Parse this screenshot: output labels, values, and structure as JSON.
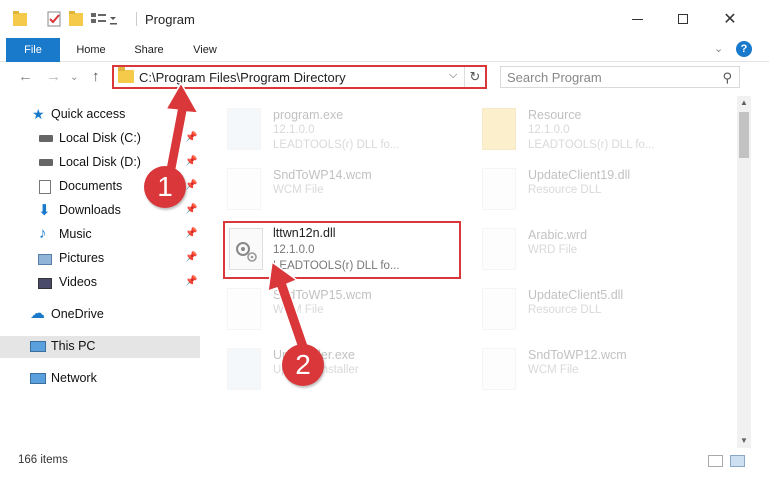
{
  "window": {
    "title": "Program",
    "controls": [
      "minimize-icon",
      "maximize-icon",
      "close-icon"
    ]
  },
  "ribbon": {
    "tabs": [
      {
        "label": "File",
        "active": true
      },
      {
        "label": "Home"
      },
      {
        "label": "Share"
      },
      {
        "label": "View"
      }
    ],
    "help_label": "?"
  },
  "address": {
    "path": "C:\\Program Files\\Program Directory",
    "refresh_icon": "↻"
  },
  "search": {
    "placeholder": "Search Program"
  },
  "sidebar": {
    "items": [
      {
        "label": "Quick access",
        "icon": "star-icon",
        "pinned": false
      },
      {
        "label": "Local Disk (C:)",
        "icon": "drive-icon",
        "pinned": true
      },
      {
        "label": "Local Disk (D:)",
        "icon": "drive-icon",
        "pinned": true
      },
      {
        "label": "Documents",
        "icon": "documents-icon",
        "pinned": true
      },
      {
        "label": "Downloads",
        "icon": "download-icon",
        "pinned": true
      },
      {
        "label": "Music",
        "icon": "music-icon",
        "pinned": true
      },
      {
        "label": "Pictures",
        "icon": "pictures-icon",
        "pinned": true
      },
      {
        "label": "Videos",
        "icon": "videos-icon",
        "pinned": true
      },
      {
        "label": "OneDrive",
        "icon": "cloud-icon",
        "pinned": false
      },
      {
        "label": "This PC",
        "icon": "computer-icon",
        "pinned": false,
        "selected": true
      },
      {
        "label": "Network",
        "icon": "network-icon",
        "pinned": false
      }
    ]
  },
  "files": [
    {
      "name": "program.exe",
      "line2": "12.1.0.0",
      "line3": "LEADTOOLS(r) DLL fo..."
    },
    {
      "name": "Resource",
      "line2": "12.1.0.0",
      "line3": "LEADTOOLS(r) DLL fo..."
    },
    {
      "name": "SndToWP14.wcm",
      "line2": "WCM File"
    },
    {
      "name": "UpdateClient19.dll",
      "line2": "Resource DLL"
    },
    {
      "name": "lttwn12n.dll",
      "line2": "12.1.0.0",
      "line3": "LEADTOOLS(r) DLL fo...",
      "highlighted": true
    },
    {
      "name": "Arabic.wrd",
      "line2": "WRD File"
    },
    {
      "name": "SndToWP15.wcm",
      "line2": "WCM File"
    },
    {
      "name": "UpdateClient5.dll",
      "line2": "Resource DLL"
    },
    {
      "name": "Uninstaller.exe",
      "line2": "Updates installer"
    },
    {
      "name": "SndToWP12.wcm",
      "line2": "WCM File"
    }
  ],
  "status": {
    "item_count": "166 items"
  },
  "callouts": [
    {
      "number": "1"
    },
    {
      "number": "2"
    }
  ],
  "colors": {
    "accent": "#1979ca",
    "callout": "#d9373a",
    "folder": "#f5c94a"
  }
}
